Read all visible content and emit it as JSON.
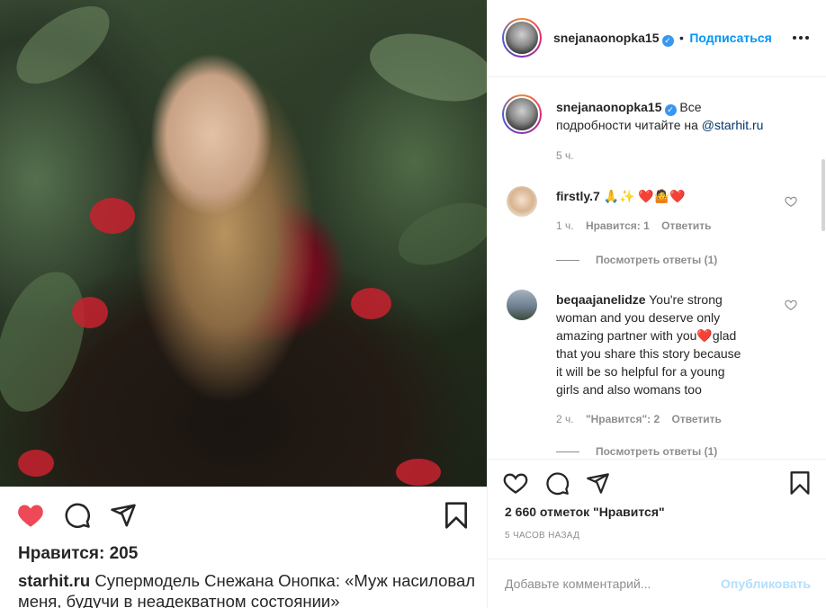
{
  "post": {
    "username": "snejanaonopka15",
    "follow_label": "Подписаться",
    "separator": "•",
    "more_icon": "more-horizontal-icon"
  },
  "left": {
    "likes_text": "Нравится: 205",
    "caption_user": "starhit.ru",
    "caption_text": "Супермодель Снежана Онопка: «Муж насиловал меня, будучи в неадекватном состоянии»"
  },
  "owner_comment": {
    "username": "snejanaonopka15",
    "text_part1": "Все",
    "text_part2": "подробности читайте на",
    "mention": "@starhit.ru",
    "time": "5 ч."
  },
  "comments": [
    {
      "username": "firstly.7",
      "text": "🙏✨ ❤️🤷❤️",
      "time": "1 ч.",
      "likes": "Нравится: 1",
      "reply": "Ответить",
      "view_replies": "Посмотреть ответы (1)"
    },
    {
      "username": "beqaajanelidze",
      "text_lines": [
        "You're strong",
        "woman and you deserve only",
        "amazing partner with you❤️glad",
        "that you share this story because",
        "it will be so helpful for a young",
        "girls and also womans too"
      ],
      "time": "2 ч.",
      "likes": "\"Нравится\": 2",
      "reply": "Ответить",
      "view_replies": "Посмотреть ответы (1)"
    }
  ],
  "right": {
    "likes_text": "2 660 отметок \"Нравится\"",
    "time_text": "5 ЧАСОВ НАЗАД",
    "comment_placeholder": "Добавьте комментарий...",
    "publish_label": "Опубликовать"
  },
  "colors": {
    "like_red": "#ed4956",
    "link_blue": "#0095f6",
    "muted": "#8e8e8e"
  }
}
